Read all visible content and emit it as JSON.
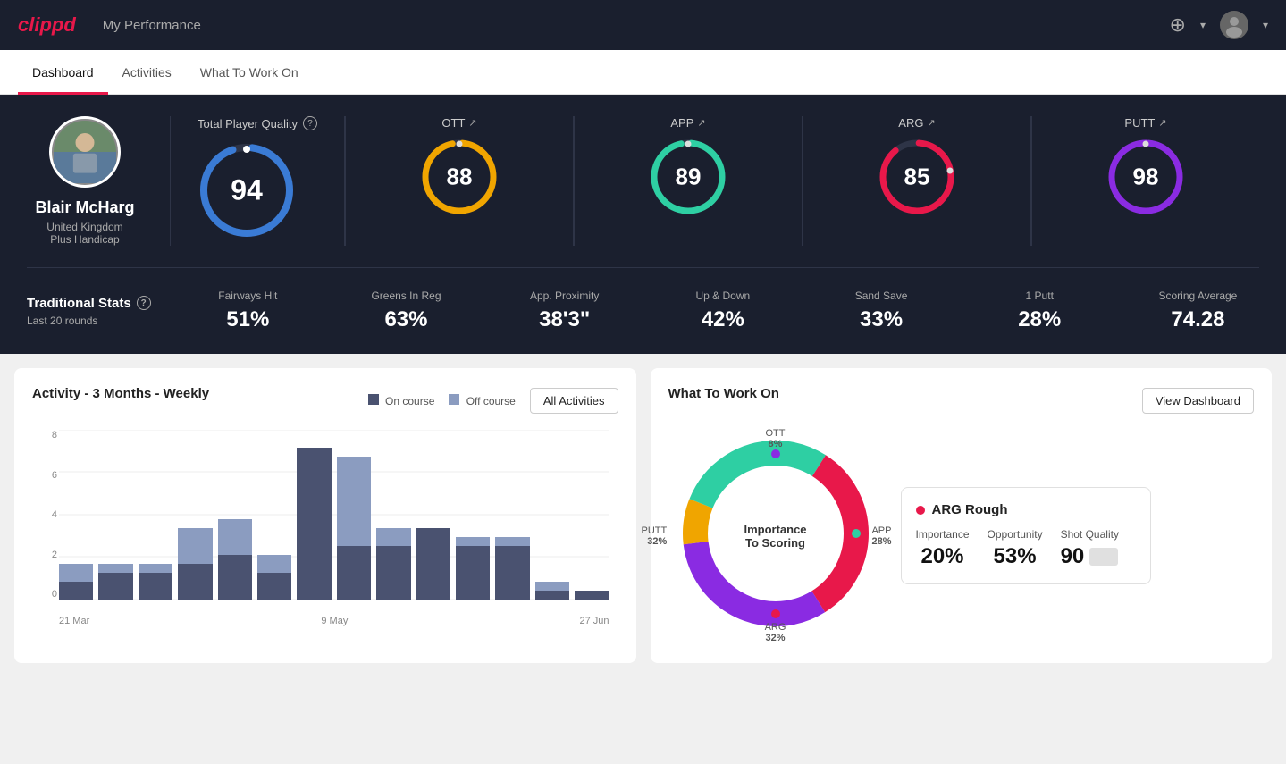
{
  "header": {
    "logo": "clippd",
    "title": "My Performance",
    "add_icon": "⊕",
    "user_icon": "👤"
  },
  "tabs": [
    {
      "id": "dashboard",
      "label": "Dashboard",
      "active": true
    },
    {
      "id": "activities",
      "label": "Activities",
      "active": false
    },
    {
      "id": "what_to_work_on",
      "label": "What To Work On",
      "active": false
    }
  ],
  "player": {
    "name": "Blair McHarg",
    "country": "United Kingdom",
    "handicap": "Plus Handicap"
  },
  "total_quality": {
    "label": "Total Player Quality",
    "value": "94",
    "color": "#3a7bd5"
  },
  "metrics": [
    {
      "id": "ott",
      "label": "OTT",
      "value": "88",
      "color": "#f0a500",
      "trend": "↗"
    },
    {
      "id": "app",
      "label": "APP",
      "value": "89",
      "color": "#2ecfa3",
      "trend": "↗"
    },
    {
      "id": "arg",
      "label": "ARG",
      "value": "85",
      "color": "#e8184a",
      "trend": "↗"
    },
    {
      "id": "putt",
      "label": "PUTT",
      "value": "98",
      "color": "#8a2be2",
      "trend": "↗"
    }
  ],
  "trad_stats": {
    "title": "Traditional Stats",
    "subtitle": "Last 20 rounds",
    "items": [
      {
        "label": "Fairways Hit",
        "value": "51%"
      },
      {
        "label": "Greens In Reg",
        "value": "63%"
      },
      {
        "label": "App. Proximity",
        "value": "38'3\""
      },
      {
        "label": "Up & Down",
        "value": "42%"
      },
      {
        "label": "Sand Save",
        "value": "33%"
      },
      {
        "label": "1 Putt",
        "value": "28%"
      },
      {
        "label": "Scoring Average",
        "value": "74.28"
      }
    ]
  },
  "activity_chart": {
    "title": "Activity - 3 Months - Weekly",
    "legend_on": "On course",
    "legend_off": "Off course",
    "btn_label": "All Activities",
    "y_labels": [
      "8",
      "6",
      "4",
      "2",
      "0"
    ],
    "x_labels": [
      "21 Mar",
      "9 May",
      "27 Jun"
    ],
    "bars": [
      {
        "on": 1,
        "off": 1
      },
      {
        "on": 1.5,
        "off": 0.5
      },
      {
        "on": 1.5,
        "off": 0.5
      },
      {
        "on": 2,
        "off": 2
      },
      {
        "on": 2.5,
        "off": 2
      },
      {
        "on": 1.5,
        "off": 1
      },
      {
        "on": 8.5,
        "off": 0
      },
      {
        "on": 3,
        "off": 5
      },
      {
        "on": 3,
        "off": 1
      },
      {
        "on": 4,
        "off": 0
      },
      {
        "on": 3,
        "off": 0.5
      },
      {
        "on": 3,
        "off": 0.5
      },
      {
        "on": 0.5,
        "off": 0.5
      },
      {
        "on": 0.5,
        "off": 0
      }
    ],
    "max_y": 9
  },
  "what_to_work_on": {
    "title": "What To Work On",
    "btn_label": "View Dashboard",
    "donut_center_line1": "Importance",
    "donut_center_line2": "To Scoring",
    "segments": [
      {
        "label": "OTT",
        "pct": "8%",
        "color": "#f0a500"
      },
      {
        "label": "APP",
        "pct": "28%",
        "color": "#2ecfa3"
      },
      {
        "label": "ARG",
        "pct": "32%",
        "color": "#e8184a"
      },
      {
        "label": "PUTT",
        "pct": "32%",
        "color": "#8a2be2"
      }
    ],
    "card": {
      "title": "ARG Rough",
      "dot_color": "#e8184a",
      "metrics": [
        {
          "label": "Importance",
          "value": "20%"
        },
        {
          "label": "Opportunity",
          "value": "53%"
        },
        {
          "label": "Shot Quality",
          "value": "90"
        }
      ]
    }
  }
}
